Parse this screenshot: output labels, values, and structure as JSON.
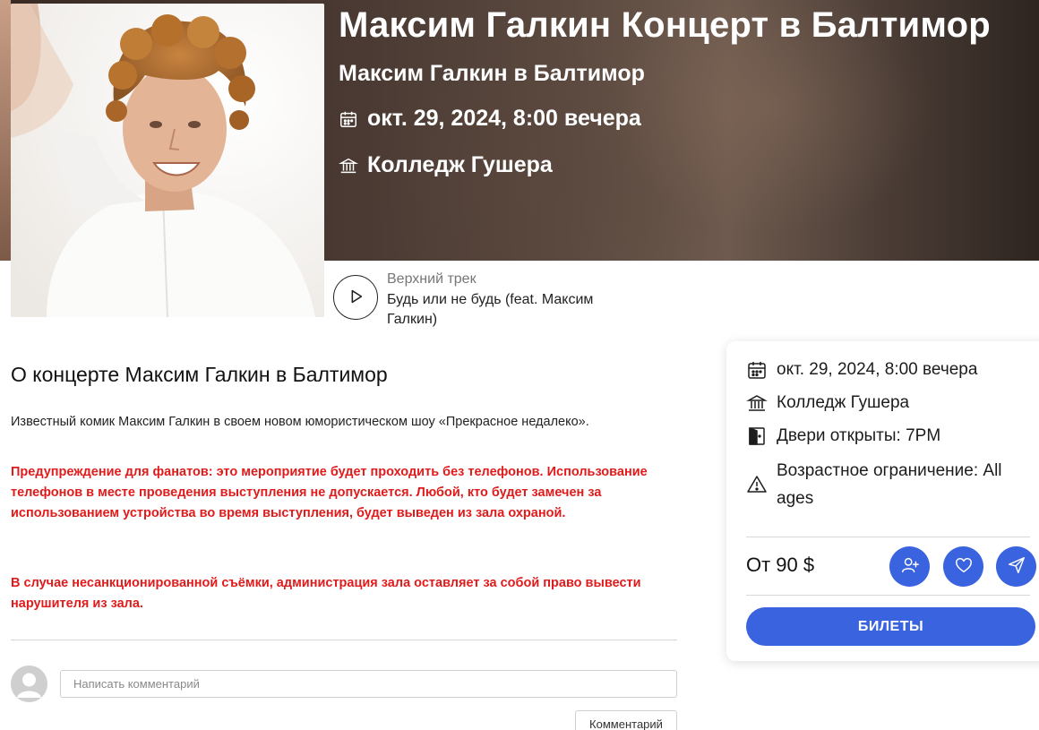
{
  "event": {
    "title": "Максим Галкин Концерт в Балтимор",
    "subtitle": "Максим Галкин в Балтимор",
    "date": "окт. 29, 2024, 8:00 вечера",
    "venue": "Колледж Гушера"
  },
  "top_track": {
    "label": "Верхний трек",
    "name": "Будь или не будь (feat. Максим Галкин)"
  },
  "about": {
    "title": "О концерте Максим Галкин в Балтимор",
    "description": "Известный комик Максим Галкин в своем новом юмористическом шоу «Прекрасное недалеко».",
    "warning_1": "Предупреждение для фанатов: это мероприятие будет проходить без телефонов. Использование телефонов в месте проведения выступления не допускается. Любой, кто будет замечен за использованием устройства во время выступления, будет выведен из зала охраной.",
    "warning_2": "В случае несанкционированной съёмки, администрация зала оставляет за собой право вывести нарушителя из зала."
  },
  "comments": {
    "placeholder": "Написать комментарий",
    "button_label": "Комментарий"
  },
  "card": {
    "date": "окт. 29, 2024, 8:00 вечера",
    "venue": "Колледж Гушера",
    "doors": "Двери открыты: 7PM",
    "age": "Возрастное ограничение: All ages",
    "price": "От 90 $",
    "tickets_label": "БИЛЕТЫ",
    "accent_color": "#3a63e0"
  },
  "icons": {
    "date": "calendar-icon",
    "venue": "building-icon",
    "doors": "door-icon",
    "age": "warning-icon",
    "follow": "add-user-icon",
    "favorite": "heart-icon",
    "share": "send-icon",
    "play": "play-icon"
  }
}
